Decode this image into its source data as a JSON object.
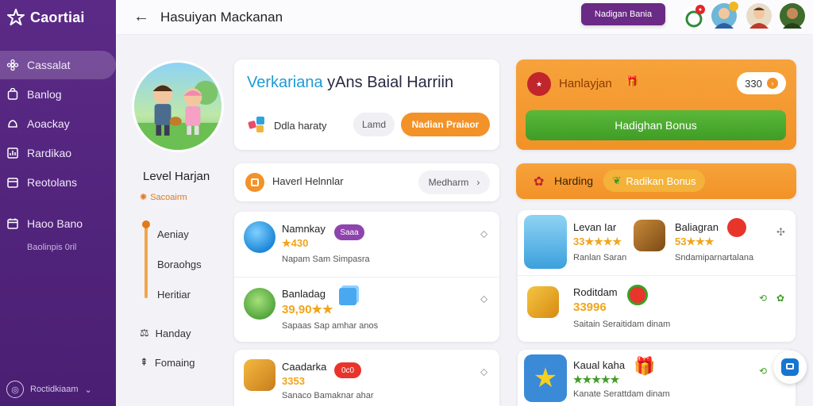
{
  "brand": {
    "name": "Caortiai"
  },
  "sidebar": {
    "items": [
      {
        "label": "Cassalat",
        "icon": "flower-icon",
        "active": true
      },
      {
        "label": "Banlog",
        "icon": "bag-icon"
      },
      {
        "label": "Aoackay",
        "icon": "bell-icon"
      },
      {
        "label": "Rardikao",
        "icon": "chart-icon"
      },
      {
        "label": "Reotolans",
        "icon": "box-icon"
      },
      {
        "label": "Haoo Bano",
        "icon": "calendar-icon"
      }
    ],
    "sub_text": "Baolinpis 0ril",
    "footer": "Roctidkiaam"
  },
  "topbar": {
    "title": "Hasuiyan Mackanan",
    "button": "Nadigan Bania"
  },
  "profile": {
    "level_title": "Level Harjan",
    "level_sub": "Sacoairm",
    "steps": [
      "Aeniay",
      "Boraohgs",
      "Heritiar"
    ],
    "links": [
      {
        "label": "Handay",
        "icon": "scale-icon"
      },
      {
        "label": "Fomaing",
        "icon": "pin-icon"
      }
    ]
  },
  "hero": {
    "title_hl": "Verkariana",
    "title_rest": " yAns Baial Harriin",
    "label": "Ddla haraty",
    "chip_plain": "Lamd",
    "chip_accent": "Nadian Praiaor"
  },
  "filter": {
    "label": "Haverl Helnnlar",
    "dropdown": "Medharm"
  },
  "list_left": [
    {
      "title": "Namnkay",
      "tag": "Saaa",
      "stars": "★430",
      "sub": "Napam Sam Simpasra"
    },
    {
      "title": "Banladag",
      "tag": "",
      "stars": "39,90★★",
      "sub": "Sapaas Sap amhar anos"
    },
    {
      "title": "Caadarka",
      "tag": "0c0",
      "stars": "3353",
      "sub": "Sanaco Bamaknar ahar"
    }
  ],
  "bonus_card": {
    "title": "Hanlayjan",
    "amount": "330",
    "button": "Hadighan Bonus"
  },
  "bonus_bar": {
    "label": "Harding",
    "chip": "Radikan Bonus"
  },
  "list_right": [
    {
      "title": "Levan Iar",
      "stars": "33★★★★",
      "sub": "Ranlan Saran"
    },
    {
      "title": "Baliagran",
      "stars": "53★★★",
      "sub": "Sndamiparnartalana"
    },
    {
      "title": "Roditdam",
      "stars": "33996",
      "sub": "Saitain Seraitidam dinam"
    },
    {
      "title": "Kaual kaha",
      "stars": "★★★★★",
      "sub": "Kanate Serattdam dinam"
    }
  ],
  "colors": {
    "purple": "#5b2a86",
    "orange": "#f29228",
    "green": "#3f9d26",
    "blue": "#1f9ad6"
  }
}
